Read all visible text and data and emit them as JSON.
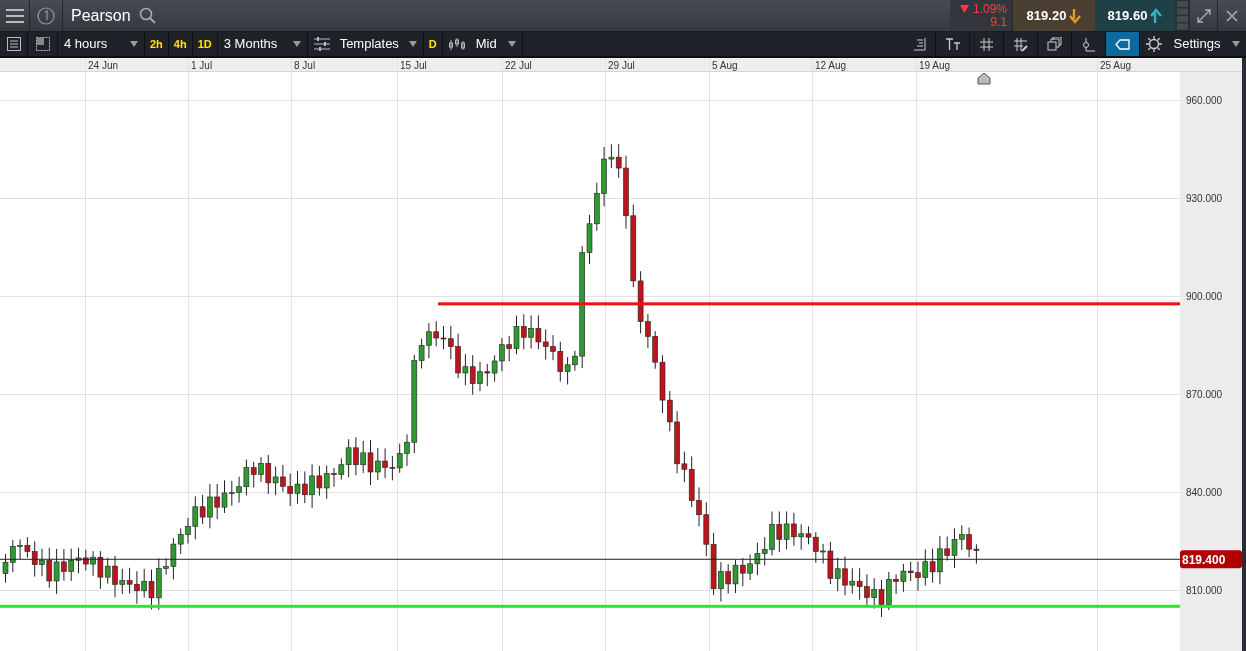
{
  "header": {
    "instrument": "Pearson",
    "change": {
      "percent": "1.09%",
      "points": "9.1"
    },
    "sell": {
      "price": "819.20"
    },
    "buy": {
      "price": "819.60"
    }
  },
  "toolbar": {
    "interval": "4 hours",
    "quick_intervals": [
      {
        "label": "2h",
        "selected": false
      },
      {
        "label": "4h",
        "selected": false
      },
      {
        "label": "1D",
        "selected": false
      }
    ],
    "range": "3 Months",
    "templates": "Templates",
    "drawing_mode": "D",
    "price_type": "Mid",
    "tools": [
      {
        "kind": "price-scale",
        "selected": false
      },
      {
        "kind": "text-size",
        "selected": false
      },
      {
        "kind": "grid",
        "selected": false
      },
      {
        "kind": "grid-draw",
        "selected": false
      },
      {
        "kind": "layers",
        "selected": false
      },
      {
        "kind": "indicator",
        "selected": false
      },
      {
        "kind": "tag",
        "selected": true
      }
    ],
    "settings": "Settings"
  },
  "chart": {
    "dates": [
      "24 Jun",
      "1 Jul",
      "8 Jul",
      "15 Jul",
      "22 Jul",
      "29 Jul",
      "5 Aug",
      "12 Aug",
      "19 Aug",
      "25 Aug"
    ],
    "yticks": [
      "960.000",
      "930.000",
      "900.000",
      "870.000",
      "840.000",
      "810.000"
    ],
    "current_price": "819.400",
    "lines": [
      {
        "color": "#ee1111"
      },
      {
        "color": "#22ee22"
      }
    ]
  }
}
